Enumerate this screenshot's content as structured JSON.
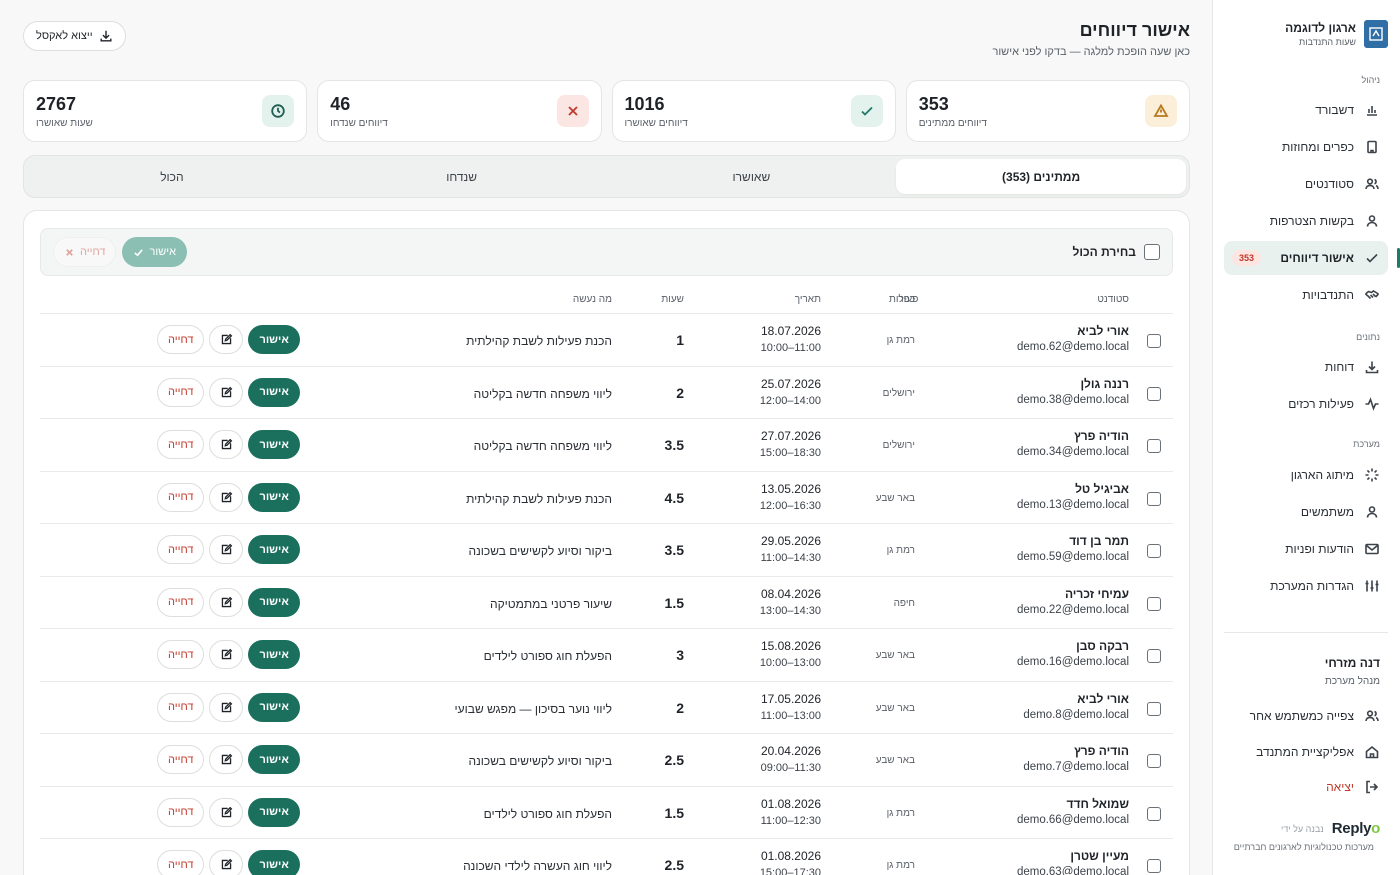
{
  "brand": {
    "name": "ארגון לדוגמה",
    "subtitle": "שעות התנדבות",
    "logo_text": "ארגון"
  },
  "sidebar": {
    "sections": {
      "manage": "ניהול",
      "data": "נתונים",
      "system": "מערכת"
    },
    "items": [
      {
        "label": "דשבורד",
        "icon": "bar-chart-icon"
      },
      {
        "label": "כפרים ומחוזות",
        "icon": "building-icon"
      },
      {
        "label": "סטודנטים",
        "icon": "users-icon"
      },
      {
        "label": "בקשות הצטרפות",
        "icon": "user-icon"
      },
      {
        "label": "אישור דיווחים",
        "icon": "check-icon",
        "badge": "353",
        "active": true
      },
      {
        "label": "התנדבויות",
        "icon": "handshake-icon"
      },
      {
        "label": "דוחות",
        "icon": "download-icon"
      },
      {
        "label": "פעילות רכזים",
        "icon": "activity-icon"
      },
      {
        "label": "מיתוג הארגון",
        "icon": "sparkle-icon"
      },
      {
        "label": "משתמשים",
        "icon": "user-icon"
      },
      {
        "label": "הודעות ופניות",
        "icon": "mail-icon"
      },
      {
        "label": "הגדרות המערכת",
        "icon": "sliders-icon"
      }
    ],
    "user": {
      "name": "דנה מזרחי",
      "role": "מנהל מערכת"
    },
    "user_items": [
      {
        "label": "צפייה כמשתמש אחר",
        "icon": "users-icon"
      },
      {
        "label": "אפליקציית המתנדב",
        "icon": "home-icon"
      },
      {
        "label": "יציאה",
        "icon": "logout-icon"
      }
    ],
    "powered": {
      "by": "נבנה על ידי",
      "logo": "Reply",
      "logo_o": "o",
      "tagline": "מערכות טכנולוגיות לארגונים חברתיים"
    }
  },
  "header": {
    "title": "אישור דיווחים",
    "subtitle": "כאן שעה הופכת למלגה — בדקו לפני אישור",
    "export_label": "ייצוא לאקסל"
  },
  "stats": [
    {
      "value": "353",
      "label": "דיווחים ממתינים",
      "icon": "warning-icon",
      "icon_bg": "#fbefd9",
      "icon_color": "#b7791f"
    },
    {
      "value": "1016",
      "label": "דיווחים שאושרו",
      "icon": "check-icon",
      "icon_bg": "#e4f2ee",
      "icon_color": "#1f7a66"
    },
    {
      "value": "46",
      "label": "דיווחים שנדחו",
      "icon": "x-icon",
      "icon_bg": "#fbe6e3",
      "icon_color": "#c0392b"
    },
    {
      "value": "2767",
      "label": "שעות שאושרו",
      "icon": "clock-icon",
      "icon_bg": "#e4f2ee",
      "icon_color": "#1f5e52"
    }
  ],
  "tabs": [
    {
      "label": "ממתינים (353)",
      "active": true
    },
    {
      "label": "שאושרו"
    },
    {
      "label": "שנדחו"
    },
    {
      "label": "הכול"
    }
  ],
  "bulk": {
    "select_all": "בחירת הכול",
    "approve": "אישור",
    "reject": "דחייה"
  },
  "table": {
    "headers": {
      "student": "סטודנט",
      "village": "כפר",
      "date": "תאריך",
      "hours": "שעות",
      "what": "מה נעשה",
      "actions": "פעולות"
    },
    "actions": {
      "approve": "אישור",
      "reject": "דחייה"
    },
    "rows": [
      {
        "name": "אורי לביא",
        "email": "demo.62@demo.local",
        "village": "רמת גן",
        "date": "18.07.2026",
        "time": "11:00–10:00",
        "hours": "1",
        "what": "הכנת פעילות לשבת קהילתית"
      },
      {
        "name": "רננה גולן",
        "email": "demo.38@demo.local",
        "village": "ירושלים",
        "date": "25.07.2026",
        "time": "14:00–12:00",
        "hours": "2",
        "what": "ליווי משפחה חדשה בקליטה"
      },
      {
        "name": "הודיה פרץ",
        "email": "demo.34@demo.local",
        "village": "ירושלים",
        "date": "27.07.2026",
        "time": "18:30–15:00",
        "hours": "3.5",
        "what": "ליווי משפחה חדשה בקליטה"
      },
      {
        "name": "אביגיל טל",
        "email": "demo.13@demo.local",
        "village": "באר שבע",
        "date": "13.05.2026",
        "time": "16:30–12:00",
        "hours": "4.5",
        "what": "הכנת פעילות לשבת קהילתית"
      },
      {
        "name": "תמר בן דוד",
        "email": "demo.59@demo.local",
        "village": "רמת גן",
        "date": "29.05.2026",
        "time": "14:30–11:00",
        "hours": "3.5",
        "what": "ביקור וסיוע לקשישים בשכונה"
      },
      {
        "name": "עמיחי זכריה",
        "email": "demo.22@demo.local",
        "village": "חיפה",
        "date": "08.04.2026",
        "time": "14:30–13:00",
        "hours": "1.5",
        "what": "שיעור פרטני במתמטיקה"
      },
      {
        "name": "רבקה סבן",
        "email": "demo.16@demo.local",
        "village": "באר שבע",
        "date": "15.08.2026",
        "time": "13:00–10:00",
        "hours": "3",
        "what": "הפעלת חוג ספורט לילדים"
      },
      {
        "name": "אורי לביא",
        "email": "demo.8@demo.local",
        "village": "באר שבע",
        "date": "17.05.2026",
        "time": "13:00–11:00",
        "hours": "2",
        "what": "ליווי נוער בסיכון — מפגש שבועי"
      },
      {
        "name": "הודיה פרץ",
        "email": "demo.7@demo.local",
        "village": "באר שבע",
        "date": "20.04.2026",
        "time": "11:30–09:00",
        "hours": "2.5",
        "what": "ביקור וסיוע לקשישים בשכונה"
      },
      {
        "name": "שמואל חדד",
        "email": "demo.66@demo.local",
        "village": "רמת גן",
        "date": "01.08.2026",
        "time": "12:30–11:00",
        "hours": "1.5",
        "what": "הפעלת חוג ספורט לילדים"
      },
      {
        "name": "מעיין שטרן",
        "email": "demo.63@demo.local",
        "village": "רמת גן",
        "date": "01.08.2026",
        "time": "17:30–15:00",
        "hours": "2.5",
        "what": "ליווי חוג העשרה לילדי השכונה"
      }
    ]
  }
}
